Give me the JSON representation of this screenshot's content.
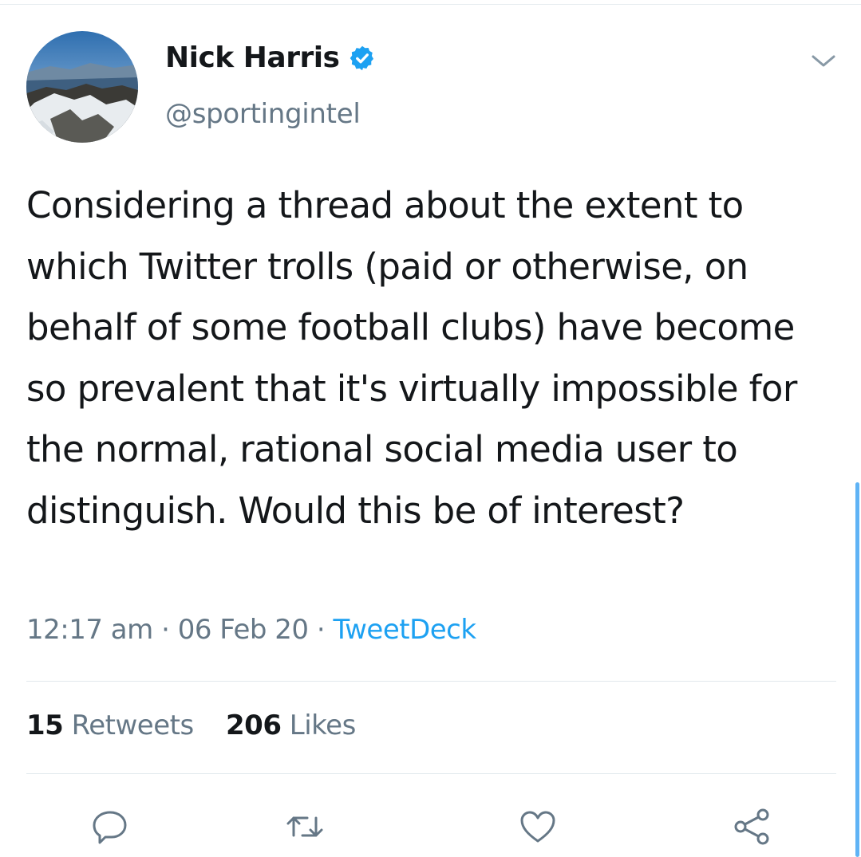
{
  "tweet": {
    "display_name": "Nick Harris",
    "handle": "@sportingintel",
    "text": "Considering a thread about the extent to which Twitter trolls (paid or otherwise, on behalf of some football clubs) have become so prevalent that it's virtually impossible for the normal, rational social media user to distinguish. Would this be of interest?",
    "time": "12:17 am",
    "date": "06 Feb 20",
    "source": "TweetDeck",
    "separator": "·"
  },
  "stats": {
    "retweets_count": "15",
    "retweets_label": "Retweets",
    "likes_count": "206",
    "likes_label": "Likes"
  },
  "icons": {
    "verified": "verified-badge-icon",
    "menu": "chevron-down-icon",
    "reply": "reply-icon",
    "retweet": "retweet-icon",
    "like": "heart-icon",
    "share": "share-icon"
  },
  "colors": {
    "accent": "#1da1f2",
    "text": "#14171a",
    "secondary": "#657786",
    "divider": "#e1e8ed"
  }
}
